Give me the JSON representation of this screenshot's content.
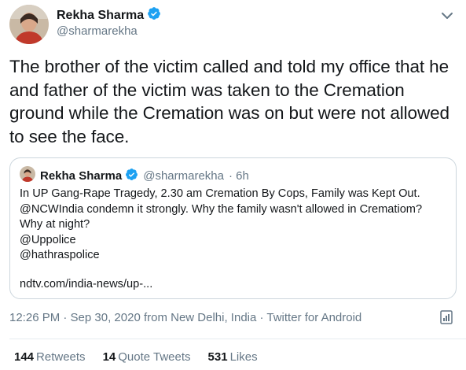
{
  "tweet": {
    "author_name": "Rekha Sharma",
    "handle": "@sharmarekha",
    "text_lines": [
      "The brother of the victim called and told my office that he",
      "and father of the victim was taken to the Cremation",
      "ground while the Cremation was on but were not allowed",
      "to see the face."
    ],
    "timestamp": "12:26 PM · Sep 30, 2020 from New Delhi, India · Twitter for Android"
  },
  "quote": {
    "author_name": "Rekha Sharma",
    "handle": "@sharmarekha",
    "age": "· 6h",
    "lines": [
      "In UP Gang-Rape Tragedy, 2.30 am Cremation By Cops, Family was Kept Out.",
      "@NCWIndia condemn it strongly. Why the family wasn't allowed in Crematiom?",
      "Why at night?",
      "@Uppolice",
      "@hathraspolice"
    ],
    "link": "ndtv.com/india-news/up-..."
  },
  "stats": {
    "retweets_count": "144",
    "retweets_label": "Retweets",
    "quotes_count": "14",
    "quotes_label": "Quote Tweets",
    "likes_count": "531",
    "likes_label": "Likes"
  },
  "icons": {
    "verified": "verified-badge-icon",
    "caret": "chevron-down-icon",
    "analytics": "analytics-icon"
  },
  "colors": {
    "verified": "#1da1f2",
    "secondary_text": "#657786",
    "border": "#ccd6dd"
  }
}
